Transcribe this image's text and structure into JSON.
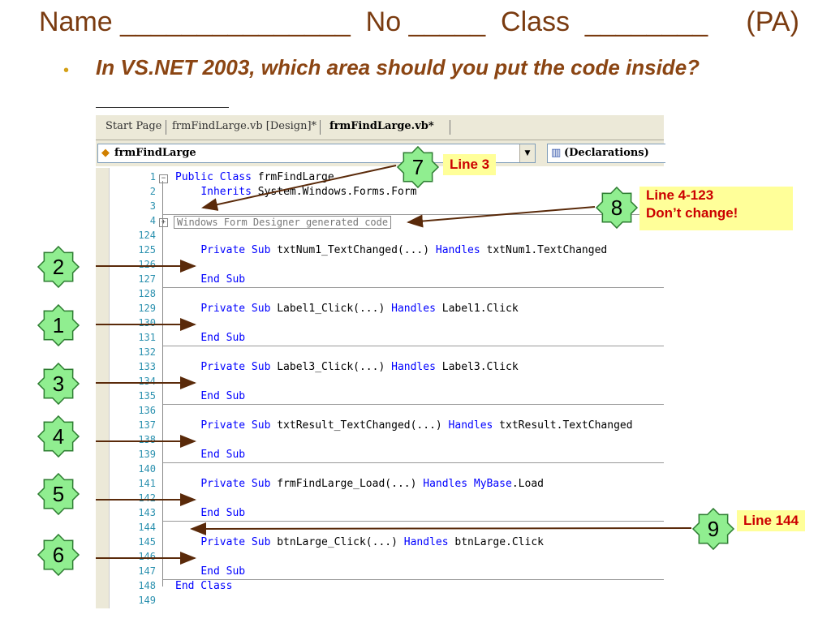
{
  "header": {
    "text": "Name _______________  No _____  Class  ________     (PA)"
  },
  "question": {
    "bullet": "•",
    "text": "In VS.NET 2003, which area should you put the code inside?"
  },
  "ide": {
    "tabs": [
      "Start Page",
      "frmFindLarge.vb [Design]*",
      "frmFindLarge.vb*"
    ],
    "class_combo": "frmFindLarge",
    "method_combo": "(Declarations)",
    "lines": [
      {
        "num": "1",
        "parts": [
          [
            "kw",
            "Public Class"
          ],
          [
            "",
            "frmFindLarge"
          ]
        ]
      },
      {
        "num": "2",
        "parts": [
          [
            "",
            "    "
          ],
          [
            "kw",
            "Inherits"
          ],
          [
            "",
            "System.Windows.Forms.Form"
          ]
        ]
      },
      {
        "num": "3",
        "parts": []
      },
      {
        "num": "4",
        "parts": [
          [
            "",
            "Windows Form Designer generated code"
          ]
        ]
      },
      {
        "num": "124",
        "parts": []
      },
      {
        "num": "125",
        "parts": [
          [
            "",
            "    "
          ],
          [
            "kw",
            "Private Sub"
          ],
          [
            "",
            "txtNum1_TextChanged(...)"
          ],
          [
            "kw",
            "Handles"
          ],
          [
            "",
            "txtNum1.TextChanged"
          ]
        ]
      },
      {
        "num": "126",
        "parts": []
      },
      {
        "num": "127",
        "parts": [
          [
            "",
            "    "
          ],
          [
            "kw",
            "End Sub"
          ]
        ]
      },
      {
        "num": "128",
        "parts": []
      },
      {
        "num": "129",
        "parts": [
          [
            "",
            "    "
          ],
          [
            "kw",
            "Private Sub"
          ],
          [
            "",
            "Label1_Click(...)"
          ],
          [
            "kw",
            "Handles"
          ],
          [
            "",
            "Label1.Click"
          ]
        ]
      },
      {
        "num": "130",
        "parts": []
      },
      {
        "num": "131",
        "parts": [
          [
            "",
            "    "
          ],
          [
            "kw",
            "End Sub"
          ]
        ]
      },
      {
        "num": "132",
        "parts": []
      },
      {
        "num": "133",
        "parts": [
          [
            "",
            "    "
          ],
          [
            "kw",
            "Private Sub"
          ],
          [
            "",
            "Label3_Click(...)"
          ],
          [
            "kw",
            "Handles"
          ],
          [
            "",
            "Label3.Click"
          ]
        ]
      },
      {
        "num": "134",
        "parts": []
      },
      {
        "num": "135",
        "parts": [
          [
            "",
            "    "
          ],
          [
            "kw",
            "End Sub"
          ]
        ]
      },
      {
        "num": "136",
        "parts": []
      },
      {
        "num": "137",
        "parts": [
          [
            "",
            "    "
          ],
          [
            "kw",
            "Private Sub"
          ],
          [
            "",
            "txtResult_TextChanged(...)"
          ],
          [
            "kw",
            "Handles"
          ],
          [
            "",
            "txtResult.TextChanged"
          ]
        ]
      },
      {
        "num": "138",
        "parts": []
      },
      {
        "num": "139",
        "parts": [
          [
            "",
            "    "
          ],
          [
            "kw",
            "End Sub"
          ]
        ]
      },
      {
        "num": "140",
        "parts": []
      },
      {
        "num": "141",
        "parts": [
          [
            "",
            "    "
          ],
          [
            "kw",
            "Private Sub"
          ],
          [
            "",
            "frmFindLarge_Load(...)"
          ],
          [
            "kw",
            "Handles"
          ],
          [
            "kw",
            "MyBase"
          ],
          [
            "",
            ".Load"
          ]
        ]
      },
      {
        "num": "142",
        "parts": []
      },
      {
        "num": "143",
        "parts": [
          [
            "",
            "    "
          ],
          [
            "kw",
            "End Sub"
          ]
        ]
      },
      {
        "num": "144",
        "parts": []
      },
      {
        "num": "145",
        "parts": [
          [
            "",
            "    "
          ],
          [
            "kw",
            "Private Sub"
          ],
          [
            "",
            "btnLarge_Click(...)"
          ],
          [
            "kw",
            "Handles"
          ],
          [
            "",
            "btnLarge.Click"
          ]
        ]
      },
      {
        "num": "146",
        "parts": []
      },
      {
        "num": "147",
        "parts": [
          [
            "",
            "    "
          ],
          [
            "kw",
            "End Sub"
          ]
        ]
      },
      {
        "num": "148",
        "parts": [
          [
            "kw",
            "End Class"
          ]
        ]
      },
      {
        "num": "149",
        "parts": []
      }
    ]
  },
  "markers": [
    "7",
    "8",
    "2",
    "1",
    "3",
    "4",
    "5",
    "6",
    "9"
  ],
  "notes": {
    "line3": "Line 3",
    "line4_123": "Line 4-123",
    "dont_change": "Don’t change!",
    "line144": "Line 144"
  },
  "colors": {
    "star_fill": "#90ee90",
    "star_stroke": "#2e7d32",
    "note_bg": "#ffff99",
    "note_text": "#cc0000",
    "arrow": "#5a2a0a",
    "heading": "#7a3b10",
    "question": "#8b4513",
    "keyword": "#0000ff"
  }
}
